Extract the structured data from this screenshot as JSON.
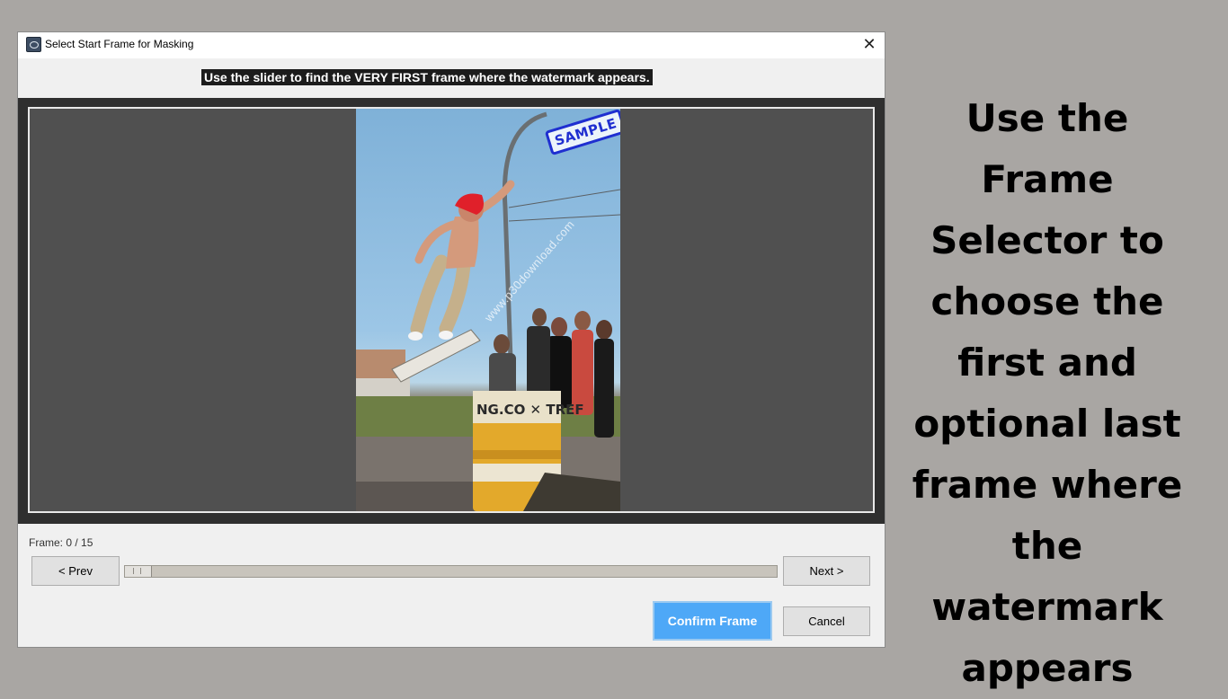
{
  "window": {
    "title": "Select Start Frame for Masking",
    "close_symbol": "✕"
  },
  "instruction": "Use the slider to find the VERY FIRST frame where the watermark appears.",
  "preview": {
    "stamp_text": "SAMPLE",
    "overlay_watermark": "www.p30download.com",
    "barrel_text": "NG.CO ✕ TREF"
  },
  "controls": {
    "frame_label": "Frame: 0 / 15",
    "prev_label": "< Prev",
    "next_label": "Next >",
    "slider": {
      "current": 0,
      "total": 15
    },
    "confirm_label": "Confirm Frame",
    "cancel_label": "Cancel"
  },
  "caption": "Use the Frame Selector to choose the first and optional last frame where the watermark appears",
  "colors": {
    "confirm_bg": "#4ea8f7",
    "background": "#a9a6a3",
    "stamp": "#1f2fd0"
  }
}
